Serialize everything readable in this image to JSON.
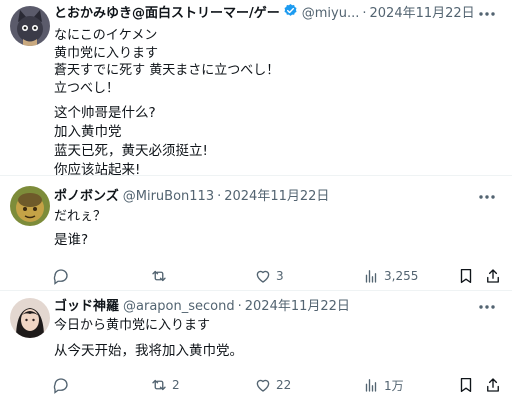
{
  "posts": [
    {
      "username": "とおかみゆき@面白ストリーマー/ゲー",
      "handle": "@miyu...",
      "date": "2024年11月22日",
      "original_lines": [
        "なにこのイケメン",
        "黄巾党に入ります",
        "蒼天すでに死す 黄天まさに立つべし！",
        "立つべし！"
      ],
      "translation_lines": [
        "这个帅哥是什么?",
        "加入黄巾党",
        "蓝天已死，黄天必须挺立!",
        "你应该站起来!"
      ]
    },
    {
      "username": "ポノボンズ",
      "handle": "@MiruBon113",
      "date": "2024年11月22日",
      "original_lines": [
        "だれぇ？"
      ],
      "translation_lines": [
        "是谁?"
      ],
      "stats": {
        "replies": "",
        "reposts": "",
        "likes": "3",
        "views": "3,255"
      }
    },
    {
      "username": "ゴッド神羅",
      "handle": "@arapon_second",
      "date": "2024年11月22日",
      "original_lines": [
        "今日から黄巾党に入ります"
      ],
      "translation_lines": [
        "从今天开始，我将加入黄巾党。"
      ],
      "stats": {
        "replies": "",
        "reposts": "2",
        "likes": "22",
        "views": "1万"
      }
    }
  ],
  "separator": "·",
  "colors": {
    "text": "#0f1419",
    "secondary": "#536471",
    "verified": "#1d9bf0",
    "divider": "#eff3f4"
  },
  "icons": [
    "reply-icon",
    "repost-icon",
    "like-icon",
    "views-icon",
    "bookmark-icon",
    "share-icon",
    "more-icon",
    "verified-icon"
  ]
}
